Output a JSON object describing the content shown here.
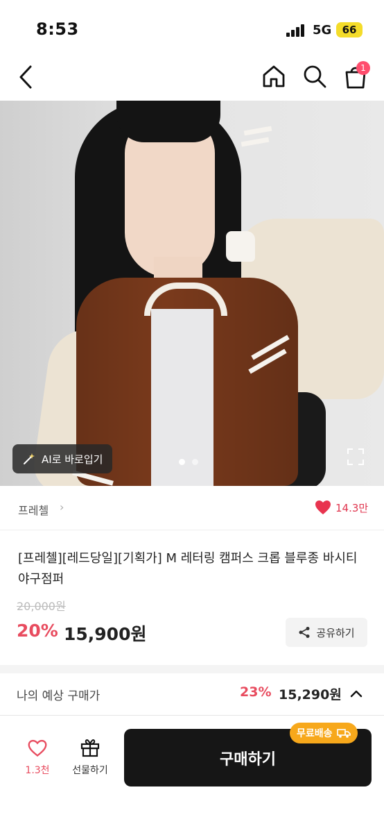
{
  "status_bar": {
    "time": "8:53",
    "network": "5G",
    "battery": "66"
  },
  "header": {
    "cart_count": "1"
  },
  "hero": {
    "ai_button_label": "AI로 바로입기",
    "slide_count": 2,
    "active_slide": 1
  },
  "brand": {
    "name": "프레첼",
    "chevron": "›",
    "like_count": "14.3만"
  },
  "product": {
    "title": "[프레첼][레드당일][기획가] M 레터링 캠퍼스 크롭 블루종 바시티 야구점퍼",
    "original_price": "20,000원",
    "discount": "20%",
    "price": "15,900원",
    "share_label": "공유하기"
  },
  "expected_price": {
    "label": "나의 예상 구매가",
    "discount": "23%",
    "price": "15,290원"
  },
  "bottom_bar": {
    "wish_count": "1.3천",
    "gift_label": "선물하기",
    "buy_label": "구매하기",
    "shipping_badge": "무료배송"
  },
  "colors": {
    "accent": "#e84c5f",
    "badge": "#ff4d6d",
    "buy_button": "#161616",
    "shipping_badge": "#f7a81b"
  }
}
